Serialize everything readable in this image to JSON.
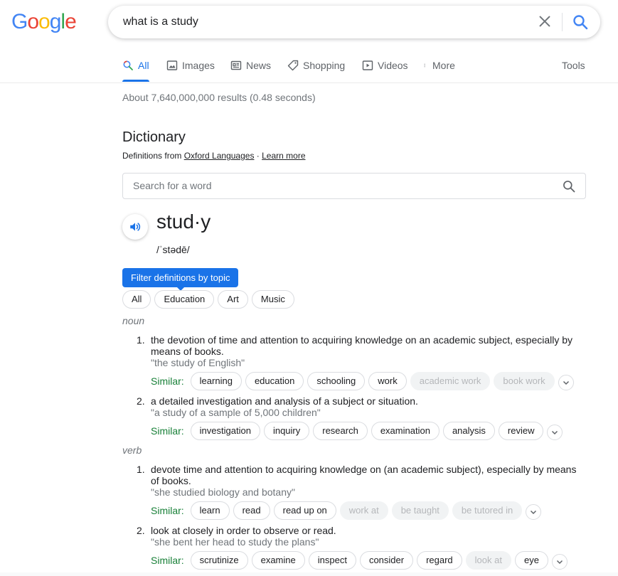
{
  "logo": {
    "letters": [
      {
        "ch": "G",
        "color": "#4285f4"
      },
      {
        "ch": "o",
        "color": "#ea4335"
      },
      {
        "ch": "o",
        "color": "#fbbc05"
      },
      {
        "ch": "g",
        "color": "#4285f4"
      },
      {
        "ch": "l",
        "color": "#34a853"
      },
      {
        "ch": "e",
        "color": "#ea4335"
      }
    ]
  },
  "search": {
    "query": "what is a study"
  },
  "nav": {
    "all": "All",
    "images": "Images",
    "news": "News",
    "shopping": "Shopping",
    "videos": "Videos",
    "more": "More",
    "tools": "Tools"
  },
  "stats": "About 7,640,000,000 results (0.48 seconds)",
  "dictionary": {
    "title": "Dictionary",
    "from_prefix": "Definitions from ",
    "source": "Oxford Languages",
    "sep": " · ",
    "learn_more": "Learn more",
    "search_placeholder": "Search for a word",
    "headword": "stud·y",
    "pronunciation": "/ˈstədē/",
    "filter_label": "Filter definitions by topic",
    "topics": [
      "All",
      "Education",
      "Art",
      "Music"
    ],
    "similar_label": "Similar:",
    "noun_label": "noun",
    "verb_label": "verb",
    "noun": [
      {
        "num": "1.",
        "def": "the devotion of time and attention to acquiring knowledge on an academic subject, especially by means of books.",
        "example": "\"the study of English\"",
        "similar": [
          "learning",
          "education",
          "schooling",
          "work"
        ],
        "similar_dim": [
          "academic work",
          "book work"
        ]
      },
      {
        "num": "2.",
        "def": "a detailed investigation and analysis of a subject or situation.",
        "example": "\"a study of a sample of 5,000 children\"",
        "similar": [
          "investigation",
          "inquiry",
          "research",
          "examination",
          "analysis",
          "review"
        ],
        "similar_dim": []
      }
    ],
    "verb": [
      {
        "num": "1.",
        "def": "devote time and attention to acquiring knowledge on (an academic subject), especially by means of books.",
        "example": "\"she studied biology and botany\"",
        "similar": [
          "learn",
          "read",
          "read up on"
        ],
        "similar_dim": [
          "work at",
          "be taught",
          "be tutored in"
        ]
      },
      {
        "num": "2.",
        "def": "look at closely in order to observe or read.",
        "example": "\"she bent her head to study the plans\"",
        "similar": [
          "scrutinize",
          "examine",
          "inspect",
          "consider",
          "regard"
        ],
        "similar_dim": [
          "look at"
        ],
        "similar_after": [
          "eye"
        ]
      }
    ]
  }
}
